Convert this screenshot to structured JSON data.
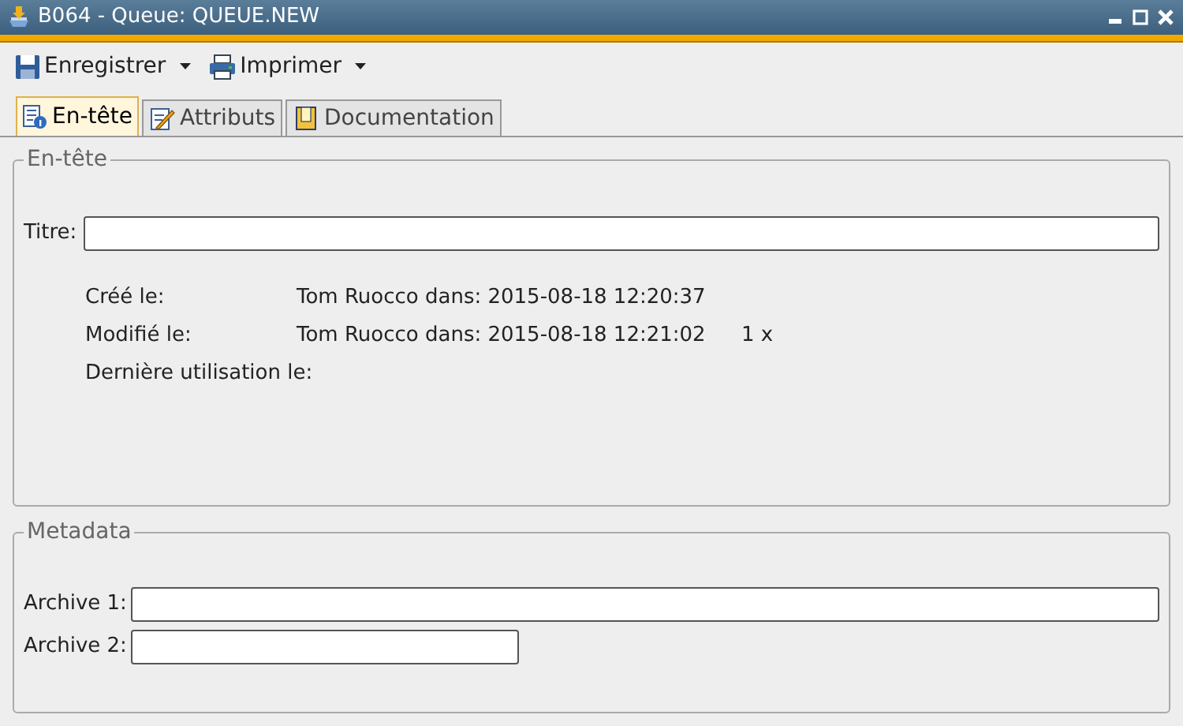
{
  "window": {
    "title": "B064 - Queue: QUEUE.NEW"
  },
  "toolbar": [
    {
      "label": "Enregistrer",
      "kind": "save"
    },
    {
      "label": "Imprimer",
      "kind": "print"
    }
  ],
  "tabs": [
    {
      "label": "En-tête",
      "kind": "info",
      "selected": true
    },
    {
      "label": "Attributs",
      "kind": "edit",
      "selected": false
    },
    {
      "label": "Documentation",
      "kind": "book",
      "selected": false
    }
  ],
  "header": {
    "title": "En-tête",
    "field_label": "Titre:",
    "info": [
      {
        "label": "Créé le:",
        "value": "Tom Ruocco dans: 2015-08-18 12:20:37"
      },
      {
        "label": "Modifié le:",
        "value": "Tom Ruocco dans: 2015-08-18 12:21:02",
        "count": "1 x"
      },
      {
        "label": "Dernière utilisation le:"
      }
    ]
  },
  "metadata": {
    "title": "Metadata",
    "fields": [
      {
        "label": "Archive 1:",
        "kind": "wide"
      },
      {
        "label": "Archive 2:",
        "kind": "narrow"
      }
    ]
  }
}
